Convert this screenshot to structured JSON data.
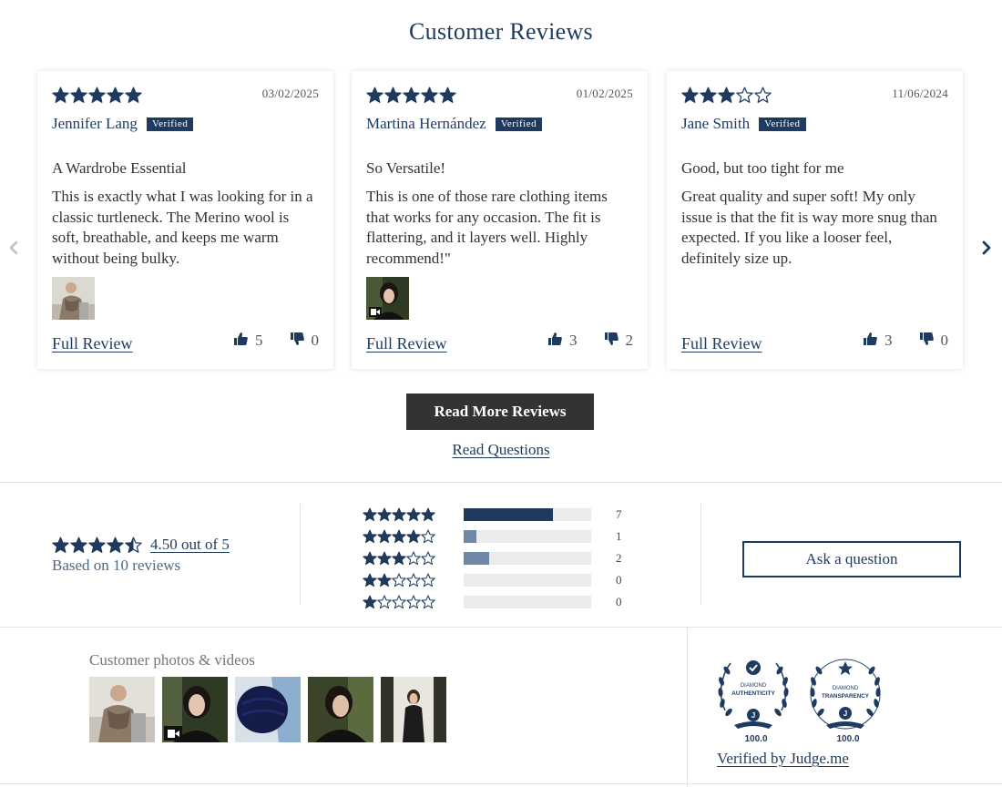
{
  "title": "Customer Reviews",
  "reviews": [
    {
      "rating": 5,
      "date": "03/02/2025",
      "author": "Jennifer Lang",
      "badge": "Verified",
      "title": "A Wardrobe Essential",
      "body": "This is exactly what I was looking for in a classic turtleneck. The Merino wool is soft, breathable, and keeps me warm without being bulky.",
      "has_media": true,
      "media_is_video": false,
      "full_review": "Full Review",
      "upvotes": "5",
      "downvotes": "0"
    },
    {
      "rating": 5,
      "date": "01/02/2025",
      "author": "Martina Hernández",
      "badge": "Verified",
      "title": "So Versatile!",
      "body": "This is one of those rare clothing items that works for any occasion. The fit is flattering, and it layers well. Highly recommend!\"",
      "has_media": true,
      "media_is_video": true,
      "full_review": "Full Review",
      "upvotes": "3",
      "downvotes": "2"
    },
    {
      "rating": 3,
      "date": "11/06/2024",
      "author": "Jane Smith",
      "badge": "Verified",
      "title": "Good, but too tight for me",
      "body": "Great quality and super soft! My only issue is that the fit is way more snug than expected. If you like a looser feel, definitely size up.",
      "has_media": false,
      "media_is_video": false,
      "full_review": "Full Review",
      "upvotes": "3",
      "downvotes": "0"
    }
  ],
  "buttons": {
    "read_more": "Read More Reviews",
    "read_questions": "Read Questions",
    "ask_question": "Ask a question"
  },
  "summary": {
    "average": 4.5,
    "average_text": "4.50 out of 5",
    "based_on": "Based on 10 reviews",
    "histogram": [
      {
        "stars": 5,
        "count": 7,
        "fraction": 0.7
      },
      {
        "stars": 4,
        "count": 1,
        "fraction": 0.1
      },
      {
        "stars": 3,
        "count": 2,
        "fraction": 0.2
      },
      {
        "stars": 2,
        "count": 0,
        "fraction": 0.0
      },
      {
        "stars": 1,
        "count": 0,
        "fraction": 0.0
      }
    ]
  },
  "media": {
    "label": "Customer photos & videos",
    "items": [
      {
        "kind": "photo",
        "palette": "scarf-outdoor"
      },
      {
        "kind": "video",
        "palette": "dark-portrait"
      },
      {
        "kind": "photo",
        "palette": "navy-knit"
      },
      {
        "kind": "photo",
        "palette": "dark-portrait-2"
      },
      {
        "kind": "photo",
        "palette": "hallway"
      }
    ]
  },
  "trust": {
    "medals": [
      {
        "line1": "DIAMOND",
        "line2": "AUTHENTICITY",
        "score": "100.0"
      },
      {
        "line1": "DIAMOND",
        "line2": "TRANSPARENCY",
        "score": "100.0"
      }
    ],
    "verified_by": "Verified by Judge.me"
  },
  "colors": {
    "brand": "#1e3a5f",
    "bar_fill_primary": "#1e3a5f",
    "bar_fill_secondary": "#6e87a4",
    "button_dark": "#333333"
  }
}
